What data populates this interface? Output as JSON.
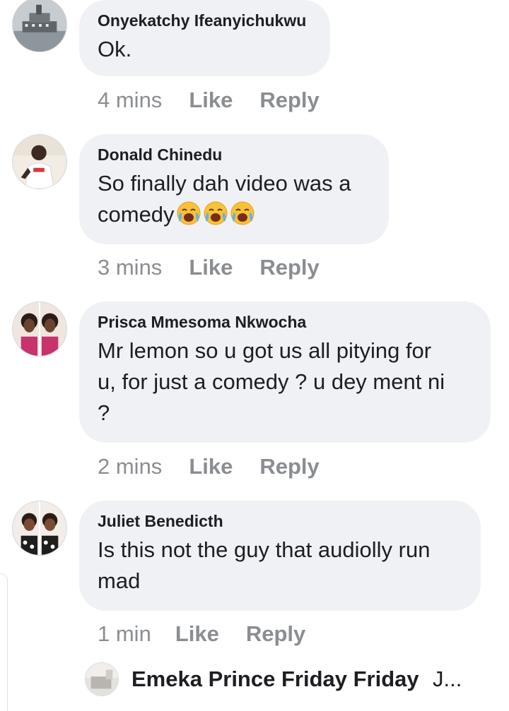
{
  "comments": [
    {
      "author": "Onyekatchy Ifeanyichukwu",
      "text": "Ok.",
      "time": "4 mins",
      "like": "Like",
      "reply": "Reply",
      "avatar_icon": "ship-photo-avatar"
    },
    {
      "author": "Donald Chinedu",
      "text": "So finally dah video was a\ncomedy",
      "emojis": [
        "crying-laughing-face",
        "crying-laughing-face",
        "crying-laughing-face"
      ],
      "time": "3 mins",
      "like": "Like",
      "reply": "Reply",
      "avatar_icon": "person-photo-avatar"
    },
    {
      "author": "Prisca Mmesoma Nkwocha",
      "text": "Mr lemon so u got us all pitying for\nu, for just a comedy ? u dey ment ni\n?",
      "time": "2 mins",
      "like": "Like",
      "reply": "Reply",
      "avatar_icon": "two-people-photo-avatar"
    },
    {
      "author": "Juliet Benedicth",
      "text": "Is this not the guy that audiolly run\nmad",
      "time": "1 min",
      "like": "Like",
      "reply": "Reply",
      "avatar_icon": "two-people-photo-avatar"
    }
  ],
  "reply_preview": {
    "author": "Emeka Prince Friday Friday",
    "snippet": "J...",
    "avatar_icon": "room-photo-avatar"
  },
  "colors": {
    "bubble": "#f0f1f4",
    "secondary_text": "#8a8d91",
    "primary_text": "#1c1e21"
  }
}
